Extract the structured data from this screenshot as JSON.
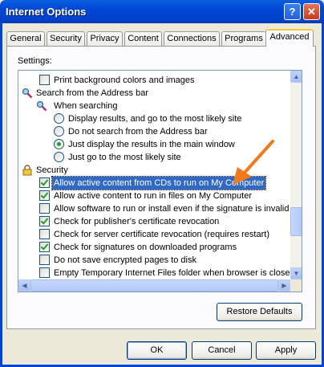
{
  "window": {
    "title": "Internet Options",
    "help_glyph": "?",
    "close_glyph": "✕"
  },
  "tabs": [
    {
      "label": "General"
    },
    {
      "label": "Security"
    },
    {
      "label": "Privacy"
    },
    {
      "label": "Content"
    },
    {
      "label": "Connections"
    },
    {
      "label": "Programs"
    },
    {
      "label": "Advanced",
      "active": true
    }
  ],
  "settings_label": "Settings:",
  "list": [
    {
      "type": "checkbox",
      "checked": false,
      "label": "Print background colors and images"
    },
    {
      "type": "category",
      "icon": "magnifier-icon",
      "label": "Search from the Address bar"
    },
    {
      "type": "category",
      "icon": "magnifier-icon",
      "label": "When searching"
    },
    {
      "type": "radio",
      "checked": false,
      "label": "Display results, and go to the most likely site"
    },
    {
      "type": "radio",
      "checked": false,
      "label": "Do not search from the Address bar"
    },
    {
      "type": "radio",
      "checked": true,
      "label": "Just display the results in the main window"
    },
    {
      "type": "radio",
      "checked": false,
      "label": "Just go to the most likely site"
    },
    {
      "type": "category",
      "icon": "lock-icon",
      "label": "Security"
    },
    {
      "type": "checkbox",
      "checked": true,
      "selected": true,
      "label": "Allow active content from CDs to run on My Computer"
    },
    {
      "type": "checkbox",
      "checked": true,
      "label": "Allow active content to run in files on My Computer"
    },
    {
      "type": "checkbox",
      "checked": false,
      "label": "Allow software to run or install even if the signature is invalid"
    },
    {
      "type": "checkbox",
      "checked": true,
      "label": "Check for publisher's certificate revocation"
    },
    {
      "type": "checkbox",
      "checked": false,
      "label": "Check for server certificate revocation (requires restart)"
    },
    {
      "type": "checkbox",
      "checked": true,
      "label": "Check for signatures on downloaded programs"
    },
    {
      "type": "checkbox",
      "checked": false,
      "label": "Do not save encrypted pages to disk"
    },
    {
      "type": "checkbox",
      "checked": false,
      "label": "Empty Temporary Internet Files folder when browser is closed"
    }
  ],
  "buttons": {
    "restore_defaults": "Restore Defaults",
    "ok": "OK",
    "cancel": "Cancel",
    "apply": "Apply"
  },
  "colors": {
    "titlebar": "#0046D5",
    "selection": "#316AC5",
    "annotation_arrow": "#F07A1C",
    "check": "#21A121"
  }
}
